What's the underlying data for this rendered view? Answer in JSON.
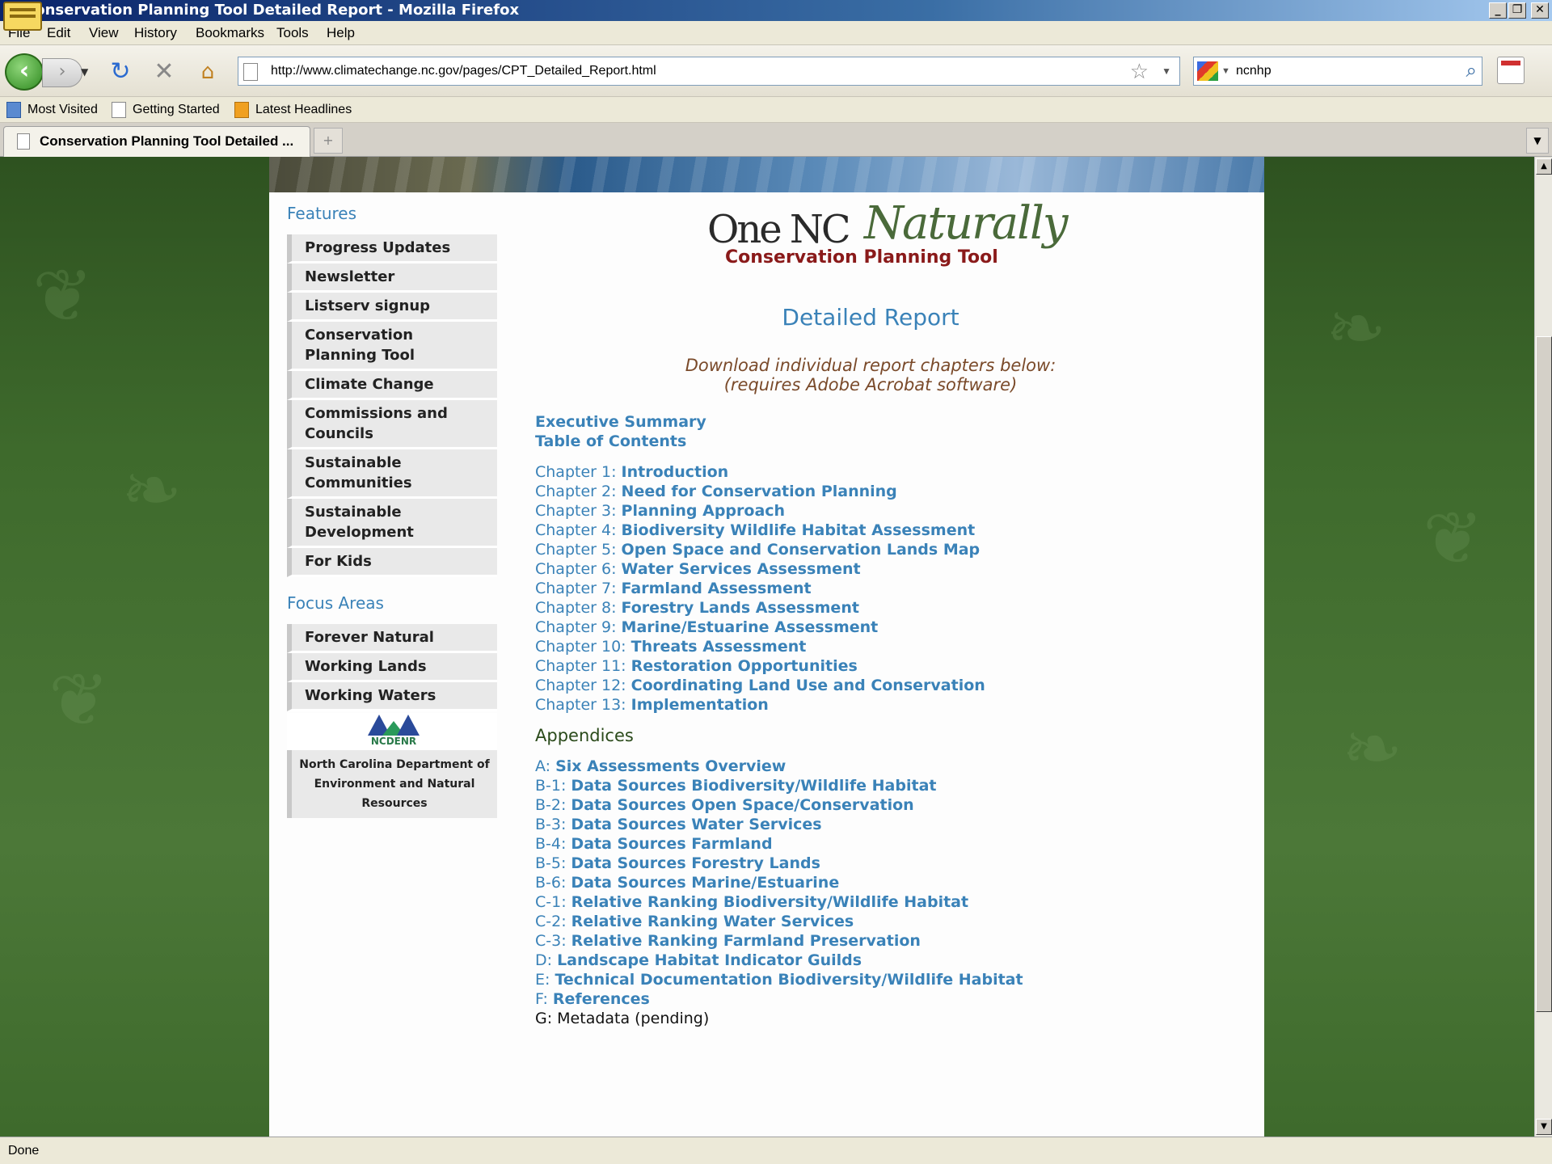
{
  "window": {
    "title": "Conservation Planning Tool Detailed Report - Mozilla Firefox"
  },
  "menu": {
    "items": [
      "File",
      "Edit",
      "View",
      "History",
      "Bookmarks",
      "Tools",
      "Help"
    ]
  },
  "nav": {
    "url": "http://www.climatechange.nc.gov/pages/CPT_Detailed_Report.html",
    "search_value": "ncnhp"
  },
  "bookmarks": {
    "items": [
      "Most Visited",
      "Getting Started",
      "Latest Headlines"
    ]
  },
  "tabs": {
    "active": "Conservation Planning Tool Detailed ..."
  },
  "sidebar": {
    "features_heading": "Features",
    "features": [
      "Progress Updates",
      "Newsletter",
      "Listserv signup",
      "Conservation Planning Tool",
      "Climate Change",
      "Commissions and Councils",
      "Sustainable Communities",
      "Sustainable Development",
      "For Kids"
    ],
    "focus_heading": "Focus Areas",
    "focus": [
      "Forever Natural",
      "Working Lands",
      "Working Waters"
    ],
    "logo_label": "NCDENR",
    "org_name": "North Carolina Department of Environment and Natural Resources"
  },
  "main": {
    "logo_one": "One NC",
    "logo_naturally": "Naturally",
    "logo_cpt": "Conservation Planning Tool",
    "title": "Detailed Report",
    "download_line1": "Download individual report chapters below:",
    "download_line2": "(requires Adobe Acrobat software)",
    "top_links": [
      "Executive Summary",
      "Table of Contents"
    ],
    "chapters": [
      {
        "prefix": "Chapter 1: ",
        "title": "Introduction"
      },
      {
        "prefix": "Chapter 2: ",
        "title": "Need for Conservation Planning"
      },
      {
        "prefix": "Chapter 3: ",
        "title": "Planning Approach"
      },
      {
        "prefix": "Chapter 4: ",
        "title": "Biodiversity Wildlife Habitat Assessment"
      },
      {
        "prefix": "Chapter 5: ",
        "title": "Open Space and Conservation Lands Map"
      },
      {
        "prefix": "Chapter 6: ",
        "title": "Water Services Assessment"
      },
      {
        "prefix": "Chapter 7: ",
        "title": "Farmland Assessment"
      },
      {
        "prefix": "Chapter 8: ",
        "title": "Forestry Lands Assessment"
      },
      {
        "prefix": "Chapter 9: ",
        "title": "Marine/Estuarine Assessment"
      },
      {
        "prefix": "Chapter 10: ",
        "title": "Threats Assessment"
      },
      {
        "prefix": "Chapter 11: ",
        "title": "Restoration Opportunities"
      },
      {
        "prefix": "Chapter 12: ",
        "title": "Coordinating Land Use and Conservation"
      },
      {
        "prefix": "Chapter 13: ",
        "title": "Implementation"
      }
    ],
    "appendices_heading": "Appendices",
    "appendices": [
      {
        "prefix": "A: ",
        "title": "Six Assessments Overview"
      },
      {
        "prefix": "B-1: ",
        "title": "Data Sources Biodiversity/Wildlife Habitat"
      },
      {
        "prefix": "B-2: ",
        "title": "Data Sources Open Space/Conservation"
      },
      {
        "prefix": "B-3: ",
        "title": "Data Sources Water Services"
      },
      {
        "prefix": "B-4: ",
        "title": "Data Sources Farmland"
      },
      {
        "prefix": "B-5: ",
        "title": "Data Sources Forestry Lands"
      },
      {
        "prefix": "B-6: ",
        "title": "Data Sources Marine/Estuarine"
      },
      {
        "prefix": "C-1: ",
        "title": "Relative Ranking Biodiversity/Wildlife Habitat"
      },
      {
        "prefix": "C-2: ",
        "title": "Relative Ranking Water Services"
      },
      {
        "prefix": "C-3: ",
        "title": "Relative Ranking Farmland Preservation"
      },
      {
        "prefix": "D: ",
        "title": "Landscape Habitat Indicator Guilds"
      },
      {
        "prefix": "E: ",
        "title": "Technical Documentation Biodiversity/Wildlife Habitat"
      },
      {
        "prefix": "F: ",
        "title": "References"
      }
    ],
    "metadata_text": "G: Metadata (pending)"
  },
  "status": {
    "text": "Done"
  }
}
